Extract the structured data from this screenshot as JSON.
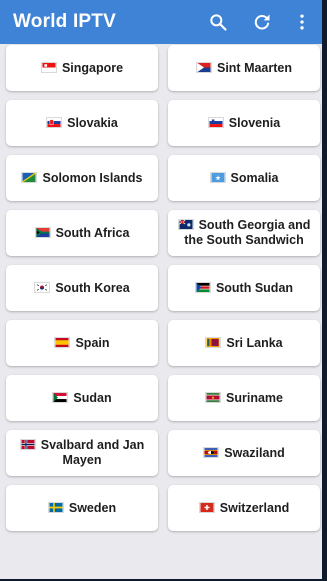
{
  "app": {
    "title": "World IPTV"
  },
  "toolbar": {
    "search_icon": "search-icon",
    "refresh_icon": "refresh-icon",
    "menu_icon": "more-vert-icon"
  },
  "colors": {
    "appbar": "#3f83d6",
    "background": "#e9e9ee",
    "card": "#ffffff"
  },
  "countries": [
    {
      "name": "Singapore",
      "flag": "singapore"
    },
    {
      "name": "Sint Maarten",
      "flag": "sint-maarten"
    },
    {
      "name": "Slovakia",
      "flag": "slovakia"
    },
    {
      "name": "Slovenia",
      "flag": "slovenia"
    },
    {
      "name": "Solomon Islands",
      "flag": "solomon-islands"
    },
    {
      "name": "Somalia",
      "flag": "somalia"
    },
    {
      "name": "South Africa",
      "flag": "south-africa"
    },
    {
      "name": "South Georgia and the South Sandwich",
      "flag": "south-georgia"
    },
    {
      "name": "South Korea",
      "flag": "south-korea"
    },
    {
      "name": "South Sudan",
      "flag": "south-sudan"
    },
    {
      "name": "Spain",
      "flag": "spain"
    },
    {
      "name": "Sri Lanka",
      "flag": "sri-lanka"
    },
    {
      "name": "Sudan",
      "flag": "sudan"
    },
    {
      "name": "Suriname",
      "flag": "suriname"
    },
    {
      "name": "Svalbard and Jan Mayen",
      "flag": "svalbard"
    },
    {
      "name": "Swaziland",
      "flag": "swaziland"
    },
    {
      "name": "Sweden",
      "flag": "sweden"
    },
    {
      "name": "Switzerland",
      "flag": "switzerland"
    }
  ]
}
